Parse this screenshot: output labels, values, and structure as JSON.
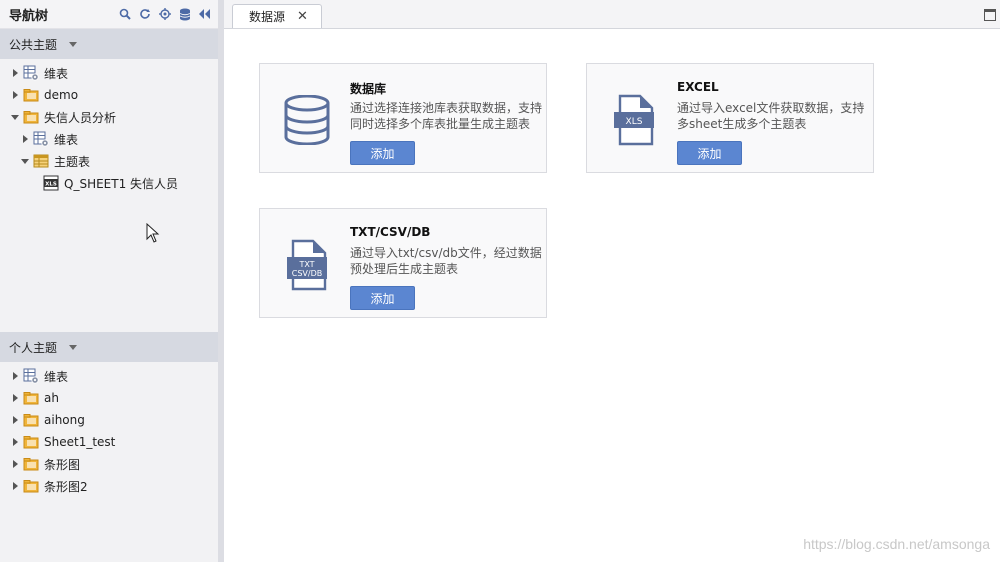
{
  "nav": {
    "title": "导航树",
    "tools": [
      "search-icon",
      "refresh-icon",
      "locate-icon",
      "database-icon",
      "collapse-icon"
    ]
  },
  "public_section": {
    "title": "公共主题",
    "items": [
      {
        "label": "维表",
        "icon": "dimension-table-icon",
        "level": 0,
        "expanded": false
      },
      {
        "label": "demo",
        "icon": "folder-icon",
        "level": 0,
        "expanded": false
      },
      {
        "label": "失信人员分析",
        "icon": "folder-icon",
        "level": 0,
        "expanded": true
      },
      {
        "label": "维表",
        "icon": "dimension-table-icon",
        "level": 1,
        "expanded": false
      },
      {
        "label": "主题表",
        "icon": "subject-table-icon",
        "level": 1,
        "expanded": true
      },
      {
        "label": "Q_SHEET1 失信人员",
        "icon": "xls-file-icon",
        "level": 2,
        "expanded": null
      }
    ]
  },
  "personal_section": {
    "title": "个人主题",
    "items": [
      {
        "label": "维表",
        "icon": "dimension-table-icon",
        "level": 0,
        "expanded": false
      },
      {
        "label": "ah",
        "icon": "folder-icon",
        "level": 0,
        "expanded": false
      },
      {
        "label": "aihong",
        "icon": "folder-icon",
        "level": 0,
        "expanded": false
      },
      {
        "label": "Sheet1_test",
        "icon": "folder-icon",
        "level": 0,
        "expanded": false
      },
      {
        "label": "条形图",
        "icon": "folder-icon",
        "level": 0,
        "expanded": false
      },
      {
        "label": "条形图2",
        "icon": "folder-icon",
        "level": 0,
        "expanded": false
      }
    ]
  },
  "tab": {
    "label": "数据源",
    "close": "✕"
  },
  "cards": [
    {
      "title": "数据库",
      "desc": "通过选择连接池库表获取数据，支持同时选择多个库表批量生成主题表",
      "button": "添加",
      "icon": "database-icon"
    },
    {
      "title": "EXCEL",
      "desc": "通过导入excel文件获取数据，支持多sheet生成多个主题表",
      "button": "添加",
      "icon": "xls-file-icon",
      "icon_text": "XLS"
    },
    {
      "title": "TXT/CSV/DB",
      "desc": "通过导入txt/csv/db文件，经过数据预处理后生成主题表",
      "button": "添加",
      "icon": "txt-csv-db-file-icon",
      "icon_text_1": "TXT",
      "icon_text_2": "CSV/DB"
    }
  ],
  "watermark": "https://blog.csdn.net/amsonga",
  "colors": {
    "accent": "#5b86d1",
    "icon_blue": "#5a6f9c",
    "folder": "#f0b43a"
  }
}
